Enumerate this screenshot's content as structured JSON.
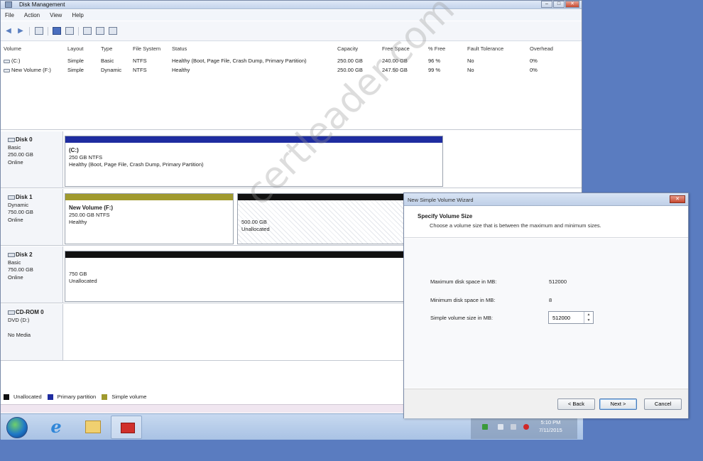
{
  "window": {
    "title": "Disk Management",
    "controls": [
      "–",
      "□",
      "✕"
    ]
  },
  "menu": [
    "File",
    "Action",
    "View",
    "Help"
  ],
  "volume_table": {
    "columns": [
      "Volume",
      "Layout",
      "Type",
      "File System",
      "Status",
      "Capacity",
      "Free Space",
      "% Free",
      "Fault Tolerance",
      "Overhead"
    ],
    "rows": [
      [
        "(C:)",
        "Simple",
        "Basic",
        "NTFS",
        "Healthy (Boot, Page File, Crash Dump, Primary Partition)",
        "250.00 GB",
        "240.00 GB",
        "96 %",
        "No",
        "0%"
      ],
      [
        "New Volume (F:)",
        "Simple",
        "Dynamic",
        "NTFS",
        "Healthy",
        "250.00 GB",
        "247.50 GB",
        "99 %",
        "No",
        "0%"
      ]
    ]
  },
  "disks": [
    {
      "name": "Disk 0",
      "type": "Basic",
      "size": "250.00 GB",
      "state": "Online",
      "parts": [
        {
          "title": "(C:)",
          "line1": "250 GB NTFS",
          "line2": "Healthy (Boot, Page File, Crash Dump, Primary Partition)"
        }
      ]
    },
    {
      "name": "Disk 1",
      "type": "Dynamic",
      "size": "750.00 GB",
      "state": "Online",
      "parts": [
        {
          "title": "New Volume (F:)",
          "line1": "250.00 GB NTFS",
          "line2": "Healthy"
        },
        {
          "title": "",
          "line1": "500.00 GB",
          "line2": "Unallocated"
        }
      ]
    },
    {
      "name": "Disk 2",
      "type": "Basic",
      "size": "750.00 GB",
      "state": "Online",
      "parts": [
        {
          "title": "",
          "line1": "750 GB",
          "line2": "Unallocated"
        }
      ]
    },
    {
      "name": "CD-ROM 0",
      "type": "DVD (D:)",
      "size": "",
      "state": "No Media",
      "parts": []
    }
  ],
  "legend": [
    "Unallocated",
    "Primary partition",
    "Simple volume"
  ],
  "colors": {
    "unallocated": "#111111",
    "primary": "#1f2ca0",
    "simple": "#a09a2e"
  },
  "wizard": {
    "title": "New Simple Volume Wizard",
    "heading": "Specify Volume Size",
    "subheading": "Choose a volume size that is between the maximum and minimum sizes.",
    "max_label": "Maximum disk space in MB:",
    "max_value": "512000",
    "min_label": "Minimum disk space in MB:",
    "min_value": "8",
    "size_label": "Simple volume size in MB:",
    "size_value": "512000",
    "buttons": {
      "back": "< Back",
      "next": "Next >",
      "cancel": "Cancel"
    },
    "close": "✕"
  },
  "clock": {
    "time": "5:10 PM",
    "date": "7/11/2015"
  },
  "watermark": "certleader.com"
}
